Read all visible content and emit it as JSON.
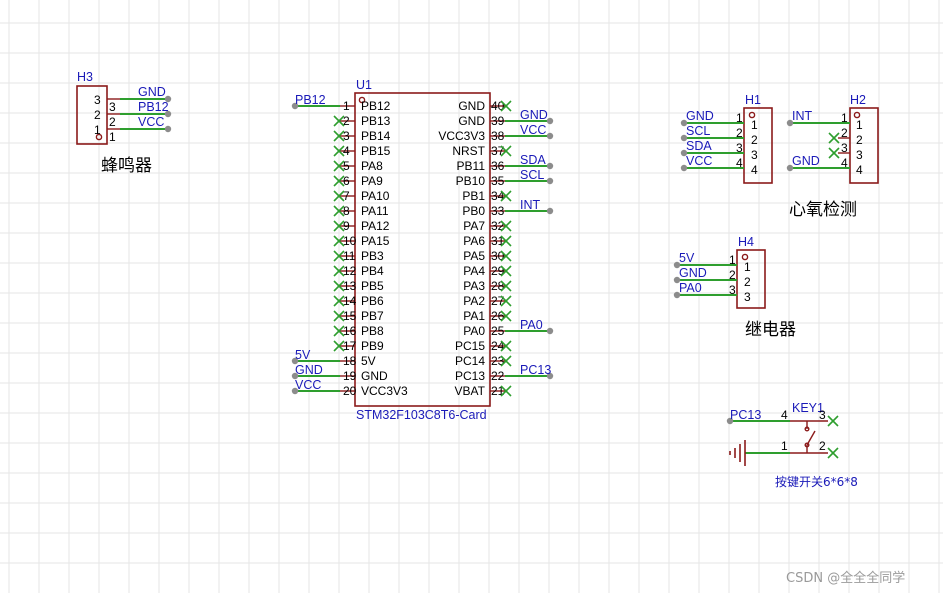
{
  "h3": {
    "ref": "H3",
    "pins": [
      "3",
      "2",
      "1"
    ],
    "pin_nums_right": [
      "3",
      "2",
      "1"
    ],
    "nets": [
      "GND",
      "PB12",
      "VCC"
    ],
    "label": "蜂鸣器"
  },
  "u1": {
    "ref": "U1",
    "value": "STM32F103C8T6-Card",
    "left_pins": [
      {
        "num": "1",
        "name": "PB12"
      },
      {
        "num": "2",
        "name": "PB13"
      },
      {
        "num": "3",
        "name": "PB14"
      },
      {
        "num": "4",
        "name": "PB15"
      },
      {
        "num": "5",
        "name": "PA8"
      },
      {
        "num": "6",
        "name": "PA9"
      },
      {
        "num": "7",
        "name": "PA10"
      },
      {
        "num": "8",
        "name": "PA11"
      },
      {
        "num": "9",
        "name": "PA12"
      },
      {
        "num": "10",
        "name": "PA15"
      },
      {
        "num": "11",
        "name": "PB3"
      },
      {
        "num": "12",
        "name": "PB4"
      },
      {
        "num": "13",
        "name": "PB5"
      },
      {
        "num": "14",
        "name": "PB6"
      },
      {
        "num": "15",
        "name": "PB7"
      },
      {
        "num": "16",
        "name": "PB8"
      },
      {
        "num": "17",
        "name": "PB9"
      },
      {
        "num": "18",
        "name": "5V"
      },
      {
        "num": "19",
        "name": "GND"
      },
      {
        "num": "20",
        "name": "VCC3V3"
      }
    ],
    "right_pins": [
      {
        "num": "40",
        "name": "GND"
      },
      {
        "num": "39",
        "name": "GND"
      },
      {
        "num": "38",
        "name": "VCC3V3"
      },
      {
        "num": "37",
        "name": "NRST"
      },
      {
        "num": "36",
        "name": "PB11"
      },
      {
        "num": "35",
        "name": "PB10"
      },
      {
        "num": "34",
        "name": "PB1"
      },
      {
        "num": "33",
        "name": "PB0"
      },
      {
        "num": "32",
        "name": "PA7"
      },
      {
        "num": "31",
        "name": "PA6"
      },
      {
        "num": "30",
        "name": "PA5"
      },
      {
        "num": "29",
        "name": "PA4"
      },
      {
        "num": "28",
        "name": "PA3"
      },
      {
        "num": "27",
        "name": "PA2"
      },
      {
        "num": "26",
        "name": "PA1"
      },
      {
        "num": "25",
        "name": "PA0"
      },
      {
        "num": "24",
        "name": "PC15"
      },
      {
        "num": "23",
        "name": "PC14"
      },
      {
        "num": "22",
        "name": "PC13"
      },
      {
        "num": "21",
        "name": "VBAT"
      }
    ],
    "left_nets": {
      "pin1": "PB12",
      "pin18": "5V",
      "pin19": "GND",
      "pin20": "VCC"
    },
    "right_nets": {
      "pin39": "GND",
      "pin38": "VCC",
      "pin36": "SDA",
      "pin35": "SCL",
      "pin33": "INT",
      "pin25": "PA0",
      "pin22": "PC13"
    }
  },
  "h1": {
    "ref": "H1",
    "pins": [
      "1",
      "2",
      "3",
      "4"
    ],
    "nets": [
      "GND",
      "SCL",
      "SDA",
      "VCC"
    ]
  },
  "h2": {
    "ref": "H2",
    "pins": [
      "1",
      "2",
      "3",
      "4"
    ],
    "nets": [
      "INT",
      "GND"
    ],
    "label": "心氧检测"
  },
  "h4": {
    "ref": "H4",
    "pins": [
      "1",
      "2",
      "3"
    ],
    "nets": [
      "5V",
      "GND",
      "PA0"
    ],
    "label": "继电器"
  },
  "key1": {
    "ref": "KEY1",
    "pins": [
      "4",
      "3",
      "1",
      "2"
    ],
    "net": "PC13",
    "label": "按键开关6*6*8"
  },
  "watermark": "CSDN @全全全同学",
  "colors": {
    "part": "#8b1a1a",
    "wire": "#2e9e2e",
    "label": "#1a1ab8",
    "grid": "#e6e6e6"
  }
}
